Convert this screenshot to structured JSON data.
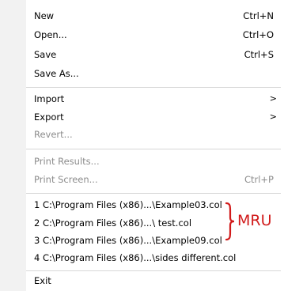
{
  "menu": {
    "group1": [
      {
        "label": "New",
        "shortcut": "Ctrl+N"
      },
      {
        "label": "Open...",
        "shortcut": "Ctrl+O"
      },
      {
        "label": "Save",
        "shortcut": "Ctrl+S"
      },
      {
        "label": "Save As...",
        "shortcut": ""
      }
    ],
    "group2": [
      {
        "label": "Import",
        "has_submenu": true
      },
      {
        "label": "Export",
        "has_submenu": true
      },
      {
        "label": "Revert...",
        "disabled": true
      }
    ],
    "group3": [
      {
        "label": "Print Results...",
        "shortcut": "",
        "disabled": true
      },
      {
        "label": "Print Screen...",
        "shortcut": "Ctrl+P",
        "disabled": true
      }
    ],
    "recent_files": [
      "1 C:\\Program Files (x86)...\\Example03.col",
      "2 C:\\Program Files (x86)...\\ test.col",
      "3 C:\\Program Files (x86)...\\Example09.col",
      "4 C:\\Program Files (x86)...\\sides different.col"
    ],
    "exit_label": "Exit",
    "submenu_arrow": ">"
  },
  "annotation": {
    "label": "MRU",
    "color": "#d11b1b"
  }
}
